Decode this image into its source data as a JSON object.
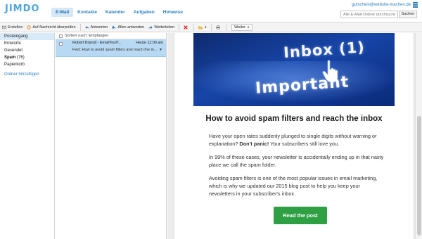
{
  "app": {
    "logo_text": "JIMDO",
    "user_email": "gutschein@website-machen.de"
  },
  "nav": {
    "items": [
      {
        "label": "E-Mail",
        "active": true
      },
      {
        "label": "Kontakte",
        "active": false
      },
      {
        "label": "Kalender",
        "active": false
      },
      {
        "label": "Aufgaben",
        "active": false
      },
      {
        "label": "Hinweise",
        "active": false
      }
    ]
  },
  "search": {
    "placeholder": "Alle E-Mail-Ordner durchsuchen",
    "button_label": "Suchen"
  },
  "toolbar": {
    "create": "Erstellen",
    "check": "Auf Nachricht überprüfen",
    "reply": "Antworten",
    "reply_all": "Allen antworten",
    "forward": "Weiterleiten",
    "more": "Weiter"
  },
  "sidebar": {
    "items": [
      {
        "label": "Posteingang",
        "count": ""
      },
      {
        "label": "Entwürfe",
        "count": ""
      },
      {
        "label": "Gesendet",
        "count": ""
      },
      {
        "label": "Spam",
        "count": "(76)"
      },
      {
        "label": "Papierkorb",
        "count": ""
      }
    ],
    "add_folder": "Ordner hinzufügen"
  },
  "message_list": {
    "sort_label": "Sortiert nach: Empfangen",
    "messages": [
      {
        "from": "Robert Brandl - EmailToolT...",
        "time": "Heute 11:00 am",
        "subject": "Fwd: How to avoid spam filters and reach the in..."
      }
    ]
  },
  "email": {
    "banner_line1": "Inbox (1)",
    "banner_line2": "Important",
    "headline": "How to avoid spam filters and reach the inbox",
    "p1_a": "Have your open rates suddenly plunged to single digits without warning or explanation? ",
    "p1_bold": "Don't panic!",
    "p1_b": " Your subscribers still love you.",
    "p2": "In 99% of these cases, your newsletter is accidentally ending up in that nasty place we call the spam folder.",
    "p3": "Avoiding spam filters is one of the most popular issues in email marketing, which is why we updated our 2015 blog post to help you keep your newsletters in your subscriber's inbox.",
    "cta": "Read the post"
  },
  "colors": {
    "accent": "#2b7fc1",
    "selected_row": "#b8d9f3",
    "cta": "#2ea043"
  }
}
